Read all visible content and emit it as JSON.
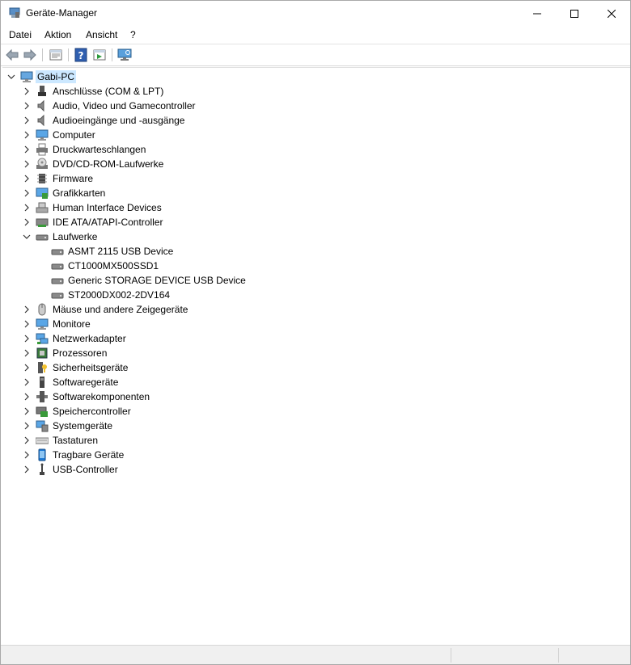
{
  "window": {
    "title": "Geräte-Manager",
    "icon": "device-manager-icon"
  },
  "menu": [
    {
      "label": "Datei"
    },
    {
      "label": "Aktion"
    },
    {
      "label": "Ansicht"
    },
    {
      "label": "?"
    }
  ],
  "toolbar": {
    "buttons": [
      "back-arrow-icon",
      "forward-arrow-icon",
      "properties-icon",
      "help-icon",
      "action-view-icon",
      "monitor-scan-icon"
    ]
  },
  "tree": {
    "root": {
      "label": "Gabi-PC",
      "icon": "computer-icon",
      "expanded": true
    },
    "categories": [
      {
        "label": "Anschlüsse (COM & LPT)",
        "icon": "port-icon"
      },
      {
        "label": "Audio, Video und Gamecontroller",
        "icon": "speaker-icon"
      },
      {
        "label": "Audioeingänge und -ausgänge",
        "icon": "speaker-icon"
      },
      {
        "label": "Computer",
        "icon": "monitor-icon"
      },
      {
        "label": "Druckwarteschlangen",
        "icon": "printer-icon"
      },
      {
        "label": "DVD/CD-ROM-Laufwerke",
        "icon": "disc-drive-icon"
      },
      {
        "label": "Firmware",
        "icon": "chip-icon"
      },
      {
        "label": "Grafikkarten",
        "icon": "display-adapter-icon"
      },
      {
        "label": "Human Interface Devices",
        "icon": "hid-icon"
      },
      {
        "label": "IDE ATA/ATAPI-Controller",
        "icon": "ide-controller-icon"
      },
      {
        "label": "Laufwerke",
        "icon": "drive-icon",
        "expanded": true,
        "children": [
          {
            "label": "ASMT 2115 USB Device",
            "icon": "drive-icon"
          },
          {
            "label": "CT1000MX500SSD1",
            "icon": "drive-icon"
          },
          {
            "label": "Generic STORAGE DEVICE USB Device",
            "icon": "drive-icon"
          },
          {
            "label": "ST2000DX002-2DV164",
            "icon": "drive-icon"
          }
        ]
      },
      {
        "label": "Mäuse und andere Zeigegeräte",
        "icon": "mouse-icon"
      },
      {
        "label": "Monitore",
        "icon": "monitor-icon"
      },
      {
        "label": "Netzwerkadapter",
        "icon": "network-icon"
      },
      {
        "label": "Prozessoren",
        "icon": "processor-icon"
      },
      {
        "label": "Sicherheitsgeräte",
        "icon": "security-key-icon"
      },
      {
        "label": "Softwaregeräte",
        "icon": "software-device-icon"
      },
      {
        "label": "Softwarekomponenten",
        "icon": "software-component-icon"
      },
      {
        "label": "Speichercontroller",
        "icon": "storage-controller-icon"
      },
      {
        "label": "Systemgeräte",
        "icon": "system-device-icon"
      },
      {
        "label": "Tastaturen",
        "icon": "keyboard-icon"
      },
      {
        "label": "Tragbare Geräte",
        "icon": "portable-device-icon"
      },
      {
        "label": "USB-Controller",
        "icon": "usb-icon"
      }
    ]
  },
  "colors": {
    "selection": "#cce8ff",
    "accent_blue": "#1e7ad6"
  }
}
